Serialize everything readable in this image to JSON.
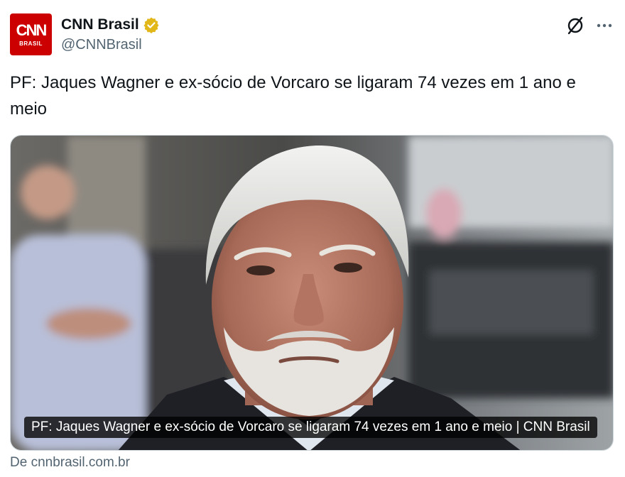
{
  "account": {
    "avatar_text": "CNN",
    "avatar_sub": "BRASIL",
    "display_name": "CNN Brasil",
    "handle": "@CNNBrasil",
    "verified": true,
    "brand_color": "#cc0000",
    "verified_color": "#e2b719"
  },
  "icons": {
    "verified": "verified-badge-icon",
    "grok": "grok-icon",
    "more": "more-options-icon"
  },
  "tweet": {
    "text": "PF: Jaques Wagner e ex-sócio de Vorcaro se ligaram 74 vezes em 1 ano e meio"
  },
  "card": {
    "caption": "PF: Jaques Wagner e ex-sócio de Vorcaro se ligaram 74 vezes em 1 ano e meio | CNN Brasil",
    "source": "De cnnbrasil.com.br"
  }
}
